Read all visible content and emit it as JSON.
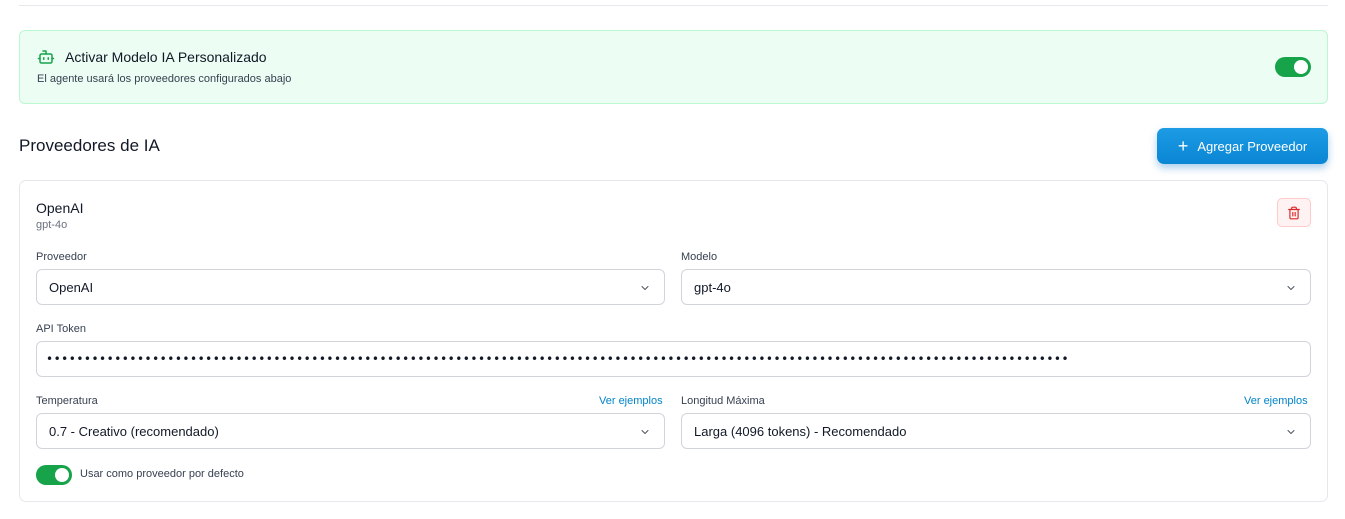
{
  "banner": {
    "title": "Activar Modelo IA Personalizado",
    "subtitle": "El agente usará los proveedores configurados abajo",
    "enabled": true,
    "icon": "robot-icon",
    "accent_color": "#16a34a",
    "background_color": "#ecfdf3"
  },
  "section": {
    "title": "Proveedores de IA",
    "add_button_label": "Agregar Proveedor",
    "add_button_color": "#0a86d4"
  },
  "provider": {
    "name": "OpenAI",
    "model_subtitle": "gpt-4o",
    "delete_icon": "trash-icon",
    "provider_label": "Proveedor",
    "provider_value": "OpenAI",
    "model_label": "Modelo",
    "model_value": "gpt-4o",
    "api_token_label": "API Token",
    "api_token_value": "•••••••••••••••••••••••••••••••••••••••••••••••••••••••••••••••••••••••••••••••••••••••••••••••••••••••••••••••••••••••••••••••••••••••",
    "temperature_label": "Temperatura",
    "temperature_value": "0.7 - Creativo (recomendado)",
    "temperature_examples_link": "Ver ejemplos",
    "max_length_label": "Longitud Máxima",
    "max_length_value": "Larga (4096 tokens) - Recomendado",
    "max_length_examples_link": "Ver ejemplos",
    "default_toggle_label": "Usar como proveedor por defecto",
    "default_enabled": true
  }
}
